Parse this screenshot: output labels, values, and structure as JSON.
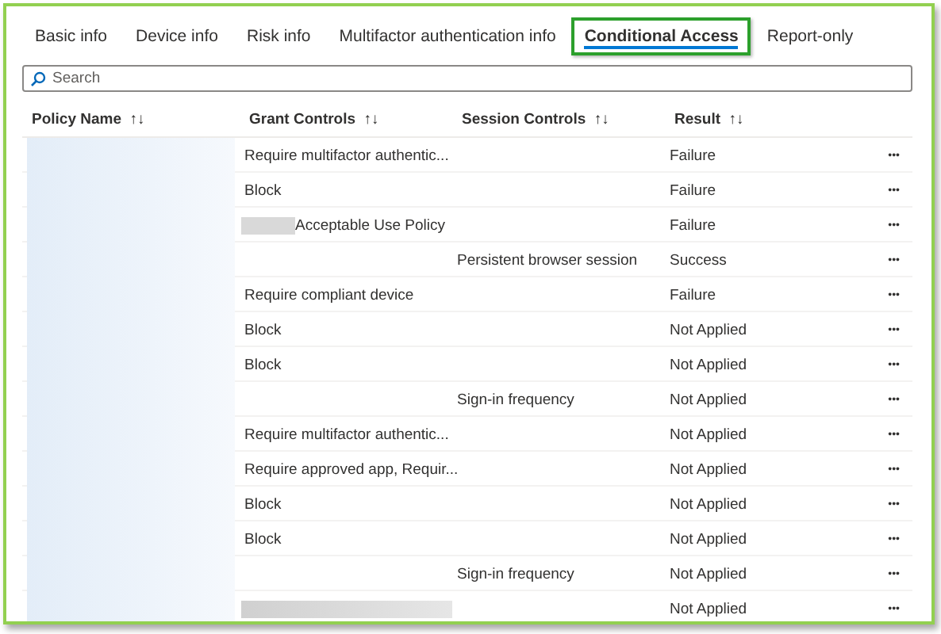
{
  "tabs": [
    {
      "label": "Basic info",
      "selected": false,
      "highlighted": false
    },
    {
      "label": "Device info",
      "selected": false,
      "highlighted": false
    },
    {
      "label": "Risk info",
      "selected": false,
      "highlighted": false
    },
    {
      "label": "Multifactor authentication info",
      "selected": false,
      "highlighted": false
    },
    {
      "label": "Conditional Access",
      "selected": true,
      "highlighted": true
    },
    {
      "label": "Report-only",
      "selected": false,
      "highlighted": false
    }
  ],
  "search": {
    "placeholder": "Search"
  },
  "table": {
    "columns": [
      {
        "label": "Policy Name",
        "sort": "↑↓"
      },
      {
        "label": "Grant Controls",
        "sort": "↑↓"
      },
      {
        "label": "Session Controls",
        "sort": "↑↓"
      },
      {
        "label": "Result",
        "sort": "↑↓"
      }
    ],
    "rows": [
      {
        "grant_redacted": false,
        "grant": "Require multifactor authentic...",
        "session": "",
        "result": "Failure",
        "more": "•••"
      },
      {
        "grant_redacted": false,
        "grant": "Block",
        "session": "",
        "result": "Failure",
        "more": "•••"
      },
      {
        "grant_redacted": true,
        "grant": "Acceptable Use Policy",
        "session": "",
        "result": "Failure",
        "more": "•••"
      },
      {
        "grant_redacted": false,
        "grant": "",
        "session": "Persistent browser session",
        "result": "Success",
        "more": "•••"
      },
      {
        "grant_redacted": false,
        "grant": "Require compliant device",
        "session": "",
        "result": "Failure",
        "more": "•••"
      },
      {
        "grant_redacted": false,
        "grant": "Block",
        "session": "",
        "result": "Not Applied",
        "more": "•••"
      },
      {
        "grant_redacted": false,
        "grant": "Block",
        "session": "",
        "result": "Not Applied",
        "more": "•••"
      },
      {
        "grant_redacted": false,
        "grant": "",
        "session": "Sign-in frequency",
        "result": "Not Applied",
        "more": "•••"
      },
      {
        "grant_redacted": false,
        "grant": "Require multifactor authentic...",
        "session": "",
        "result": "Not Applied",
        "more": "•••"
      },
      {
        "grant_redacted": false,
        "grant": "Require approved app, Requir...",
        "session": "",
        "result": "Not Applied",
        "more": "•••"
      },
      {
        "grant_redacted": false,
        "grant": "Block",
        "session": "",
        "result": "Not Applied",
        "more": "•••"
      },
      {
        "grant_redacted": false,
        "grant": "Block",
        "session": "",
        "result": "Not Applied",
        "more": "•••"
      },
      {
        "grant_redacted": false,
        "grant": "",
        "session": "Sign-in frequency",
        "result": "Not Applied",
        "more": "•••"
      },
      {
        "grant_redacted": true,
        "grant": "",
        "session": "",
        "result": "Not Applied",
        "more": "•••"
      }
    ]
  }
}
